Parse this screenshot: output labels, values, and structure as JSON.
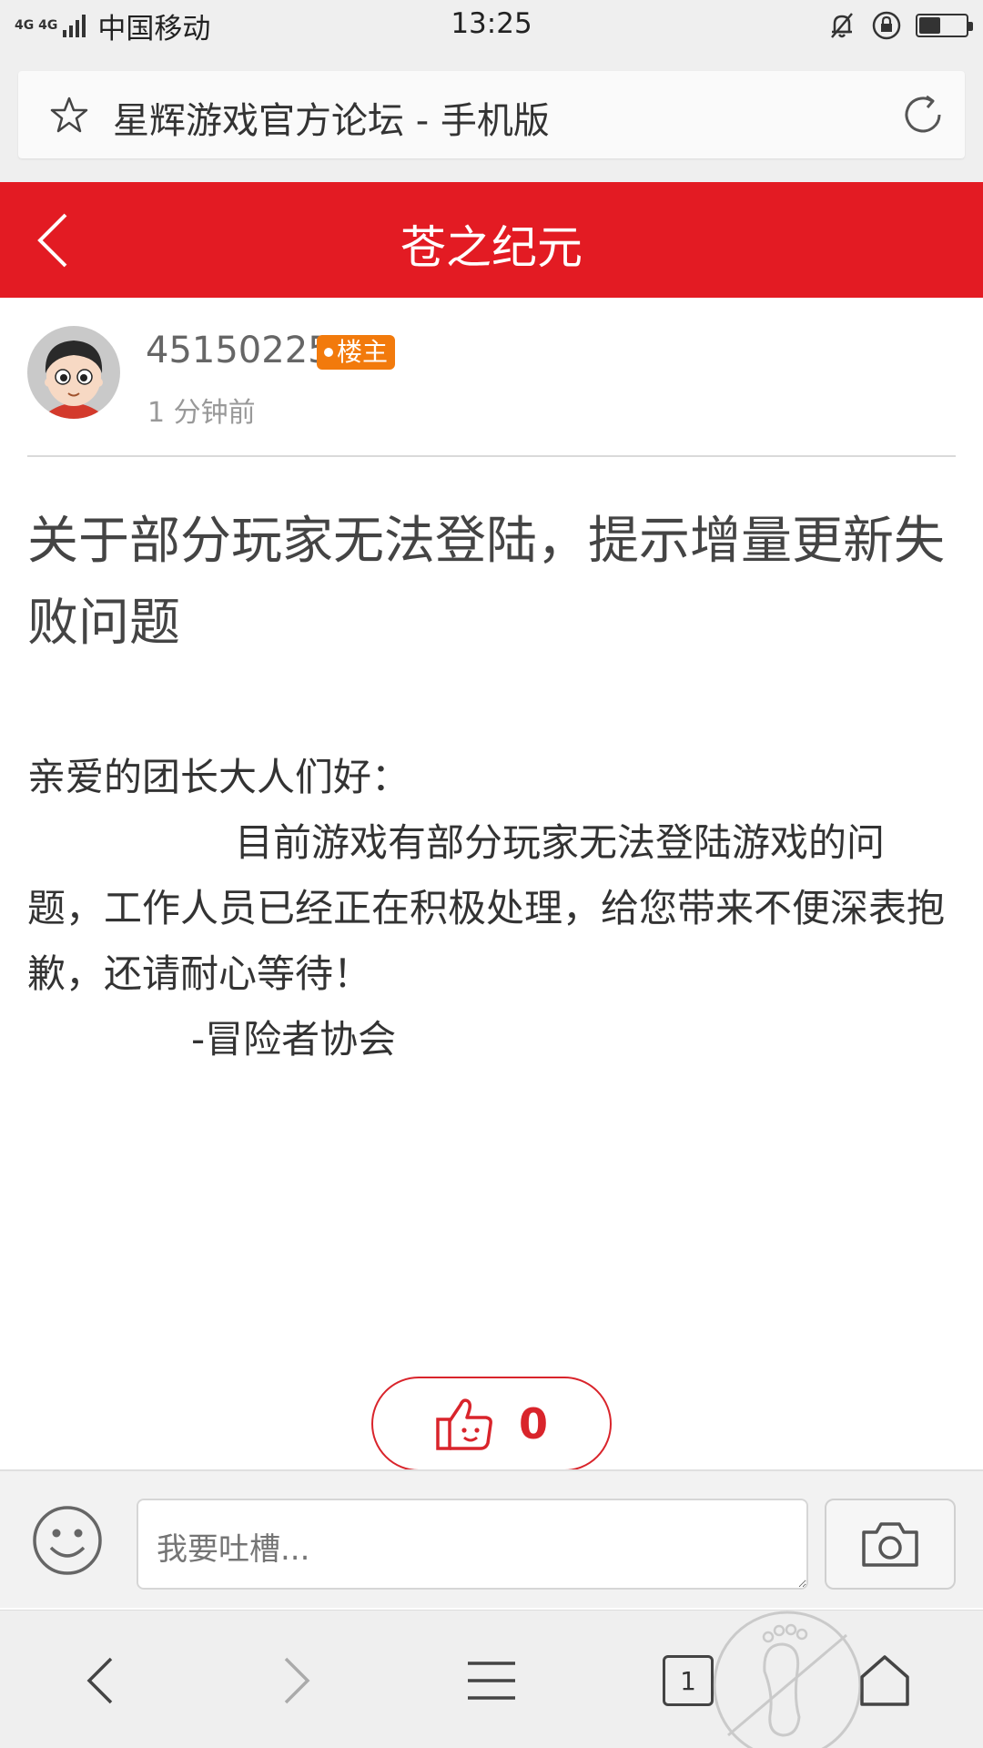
{
  "status_bar": {
    "network": "4G 4G",
    "carrier": "中国移动",
    "time": "13:25",
    "battery_level": 0.45
  },
  "url_bar": {
    "title": "星辉游戏官方论坛 - 手机版"
  },
  "header": {
    "title": "苍之纪元"
  },
  "post": {
    "author": "45150225",
    "badge": "楼主",
    "time": "1 分钟前",
    "title": "关于部分玩家无法登陆，提示增量更新失败问题",
    "greeting": "亲爱的团长大人们好：",
    "paragraph": "目前游戏有部分玩家无法登陆游戏的问题，工作人员已经正在积极处理，给您带来不便深表抱歉，还请耐心等待！",
    "signature": "-冒险者协会"
  },
  "like": {
    "count": "0"
  },
  "comment_bar": {
    "placeholder": "我要吐槽..."
  },
  "bottom_nav": {
    "tab_count": "1"
  },
  "colors": {
    "brand_red": "#e31b23",
    "badge_orange": "#f27a0c",
    "like_red": "#d9242b"
  }
}
